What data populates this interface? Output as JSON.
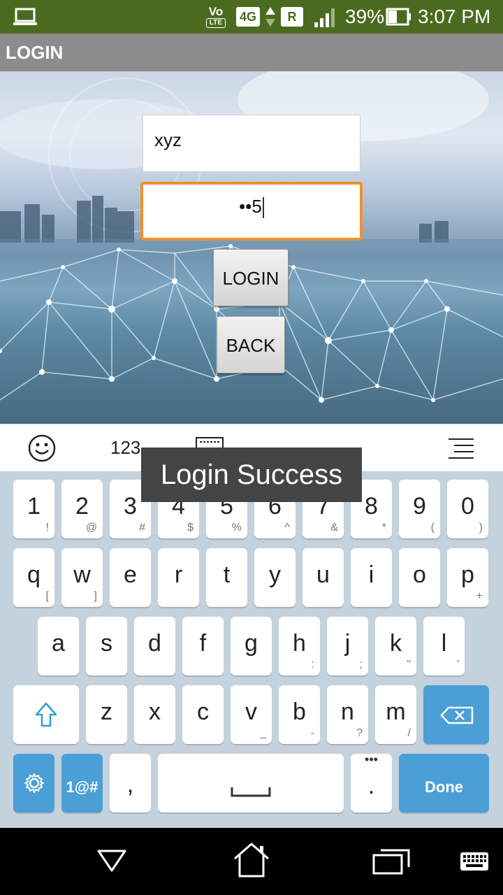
{
  "status_bar": {
    "volte": "Vo",
    "lte": "LTE",
    "network": "4G",
    "roaming": "R",
    "battery_percent": "39%",
    "time": "3:07 PM"
  },
  "action_bar": {
    "title": "LOGIN"
  },
  "form": {
    "username_value": "xyz",
    "password_value": "••5",
    "login_label": "LOGIN",
    "back_label": "BACK"
  },
  "toast": {
    "message": "Login Success"
  },
  "keyboard_toolbar": {
    "numbers_label": "123"
  },
  "keyboard": {
    "row1": [
      {
        "main": "1",
        "sub": "!"
      },
      {
        "main": "2",
        "sub": "@"
      },
      {
        "main": "3",
        "sub": "#"
      },
      {
        "main": "4",
        "sub": "$"
      },
      {
        "main": "5",
        "sub": "%"
      },
      {
        "main": "6",
        "sub": "^"
      },
      {
        "main": "7",
        "sub": "&"
      },
      {
        "main": "8",
        "sub": "*"
      },
      {
        "main": "9",
        "sub": "("
      },
      {
        "main": "0",
        "sub": ")"
      }
    ],
    "row2": [
      {
        "main": "q",
        "sub": "["
      },
      {
        "main": "w",
        "sub": "]"
      },
      {
        "main": "e",
        "sub": ""
      },
      {
        "main": "r",
        "sub": ""
      },
      {
        "main": "t",
        "sub": ""
      },
      {
        "main": "y",
        "sub": ""
      },
      {
        "main": "u",
        "sub": ""
      },
      {
        "main": "i",
        "sub": ""
      },
      {
        "main": "o",
        "sub": ""
      },
      {
        "main": "p",
        "sub": "+"
      }
    ],
    "row3": [
      {
        "main": "a",
        "sub": ""
      },
      {
        "main": "s",
        "sub": ""
      },
      {
        "main": "d",
        "sub": ""
      },
      {
        "main": "f",
        "sub": ""
      },
      {
        "main": "g",
        "sub": ""
      },
      {
        "main": "h",
        "sub": ":"
      },
      {
        "main": "j",
        "sub": ";"
      },
      {
        "main": "k",
        "sub": "\""
      },
      {
        "main": "l",
        "sub": "'"
      }
    ],
    "row4": [
      {
        "main": "z",
        "sub": ""
      },
      {
        "main": "x",
        "sub": ""
      },
      {
        "main": "c",
        "sub": ""
      },
      {
        "main": "v",
        "sub": "_"
      },
      {
        "main": "b",
        "sub": "-"
      },
      {
        "main": "n",
        "sub": "?"
      },
      {
        "main": "m",
        "sub": "/"
      }
    ],
    "symbols_label": "1@#",
    "comma": ",",
    "period": ".",
    "period_sub": "•••",
    "done_label": "Done"
  },
  "colors": {
    "status_bar": "#4a6b1f",
    "action_bar": "#8c8c8c",
    "focus_border": "#f0922a",
    "keyboard_bg": "#c3d2dd",
    "keyboard_accent": "#4a9fd6"
  }
}
